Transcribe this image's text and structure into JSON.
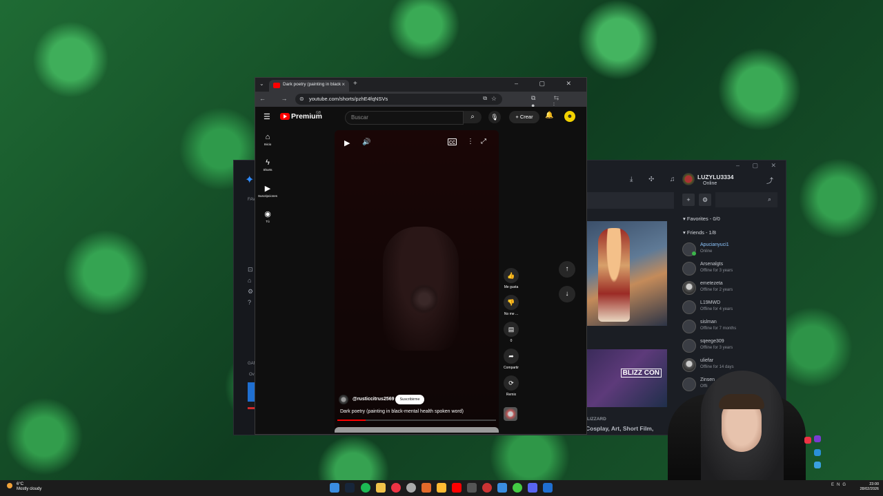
{
  "desktop": {
    "wallpaper": "forest-aerial"
  },
  "launcher": {
    "username": "LUZYLU3334",
    "user_status": "Online",
    "favorites_label": "Favorites - 0/0",
    "friends_label": "Friends - 1/8",
    "friends": [
      {
        "name": "Apucianyuci1",
        "status": "Online",
        "online": true
      },
      {
        "name": "Arsenalgts",
        "status": "Offline for 3 years"
      },
      {
        "name": "emetezeta",
        "status": "Offline for 2 years"
      },
      {
        "name": "L19MWD",
        "status": "Offline for 4 years"
      },
      {
        "name": "sislman",
        "status": "Offline for 7 months"
      },
      {
        "name": "sqeege309",
        "status": "Offline for 3 years"
      },
      {
        "name": "uliefar",
        "status": "Offline for 14 days"
      },
      {
        "name": "Zinsen",
        "status": "Offli"
      }
    ],
    "card_caption": "Cosplay, Art, Short Film,",
    "card_brand": "BLIZZ CON",
    "card_brand_caption": "LIZZARD",
    "left_label_fav": "FAV",
    "left_label_gam": "GAM",
    "left_label_ov": "Ov"
  },
  "browser": {
    "tab_title": "Dark poetry (painting in black-",
    "url": "youtube.com/shorts/pzhE4fqNSVs",
    "new_tab": "+",
    "tab_close": "×"
  },
  "youtube": {
    "brand": "Premium",
    "brand_country": "GB",
    "search_placeholder": "Buscar",
    "create_label": "Crear",
    "nav": [
      {
        "icon": "home-icon",
        "glyph": "⌂",
        "label": "Inicio"
      },
      {
        "icon": "shorts-icon",
        "glyph": "ϟ",
        "label": "Shorts"
      },
      {
        "icon": "subscriptions-icon",
        "glyph": "▶",
        "label": "Suscripciones"
      },
      {
        "icon": "you-icon",
        "glyph": "◉",
        "label": "Tú"
      }
    ],
    "channel": "@rusticcitrus2569",
    "subscribe_label": "Suscribirme",
    "video_title": "Dark poetry (painting in black-mental health spoken word)",
    "progress_fraction": 0.18,
    "actions": [
      {
        "icon": "like-icon",
        "glyph": "👍",
        "label": "Me gusta"
      },
      {
        "icon": "dislike-icon",
        "glyph": "👎",
        "label": "No me ..."
      },
      {
        "icon": "comment-icon",
        "glyph": "▤",
        "label": "0"
      },
      {
        "icon": "share-icon",
        "glyph": "➦",
        "label": "Compartir"
      },
      {
        "icon": "remix-icon",
        "glyph": "⟳",
        "label": "Remix"
      }
    ]
  },
  "taskbar": {
    "temperature": "6°C",
    "weather": "Mostly cloudy",
    "lang": "ENG",
    "time": "23:00",
    "date": "28/02/2026"
  },
  "colors": {
    "yt_red": "#ff0000",
    "online_green": "#3bb54a",
    "launcher_blue": "#2f8cff"
  }
}
